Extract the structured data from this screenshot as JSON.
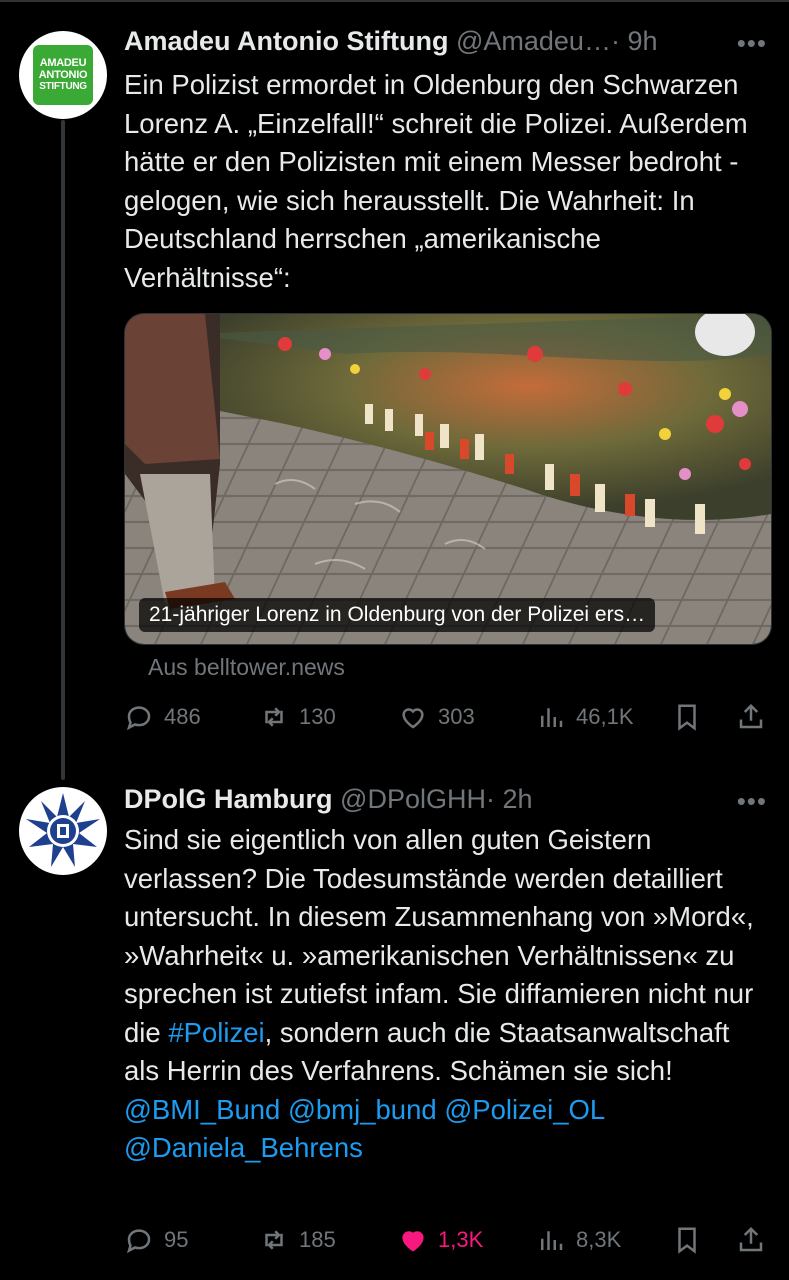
{
  "tweets": [
    {
      "author_name": "Amadeu Antonio Stiftung",
      "handle": "@Amadeu…",
      "time": "· 9h",
      "more": "•••",
      "avatar_text": [
        "AMADEU",
        "ANTONIO",
        "STIFTUNG"
      ],
      "text": "Ein Polizist ermordet in Oldenburg den Schwarzen Lorenz A. „Einzelfall!“ schreit die Polizei. Außerdem hätte er den Polizisten mit einem Messer bedroht - gelogen, wie sich herausstellt. Die Wahrheit: In Deutschland herrschen „amerikanische Verhältnisse“:",
      "card": {
        "caption": "21-jähriger Lorenz in Oldenburg von der Polizei ers…",
        "source": "Aus belltower.news"
      },
      "stats": {
        "replies": "486",
        "reposts": "130",
        "likes": "303",
        "views": "46,1K"
      }
    },
    {
      "author_name": "DPolG Hamburg",
      "handle": "@DPolGHH",
      "time": "· 2h",
      "more": "•••",
      "text_parts": {
        "before": "Sind sie eigentlich von allen guten Geistern verlassen? Die Todesumstände werden detailliert untersucht. In diesem Zusammenhang von »Mord«, »Wahrheit« u. »amerikanischen Verhältnissen« zu sprechen ist zutiefst infam. Sie diffamieren nicht nur die ",
        "hashtag": "#Polizei",
        "middle": ", sondern auch die Staatsanwaltschaft als Herrin des Verfahrens. Schämen sie sich! ",
        "mention1": "@BMI_Bund",
        "mention2": "@bmj_bund",
        "mention3": "@Polizei_OL",
        "mention4": "@Daniela_Behrens"
      },
      "stats": {
        "replies": "95",
        "reposts": "185",
        "likes": "1,3K",
        "views": "8,3K"
      }
    }
  ],
  "colors": {
    "background": "#000000",
    "link": "#1d9bf0",
    "muted": "#71767b",
    "like_active": "#f91880",
    "amadeu_green": "#3aa935"
  },
  "icons": [
    "reply-icon",
    "repost-icon",
    "like-icon",
    "views-icon",
    "bookmark-icon",
    "share-icon"
  ]
}
